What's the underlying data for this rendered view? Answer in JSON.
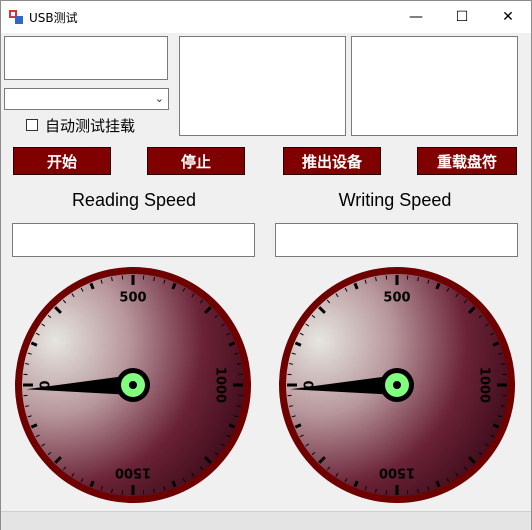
{
  "window": {
    "title": "USB测试",
    "minimize_glyph": "—",
    "maximize_glyph": "☐",
    "close_glyph": "✕"
  },
  "controls": {
    "auto_test_label": "自动测试挂载",
    "auto_test_checked": false,
    "drive_combo_value": "",
    "buttons": {
      "start": "开始",
      "stop": "停止",
      "eject": "推出设备",
      "reload": "重载盘符"
    }
  },
  "reading": {
    "title": "Reading Speed",
    "value_text": "",
    "gauge": {
      "labels": [
        "0",
        "500",
        "1000",
        "1500"
      ],
      "min": 0,
      "max": 2000,
      "value": 0
    }
  },
  "writing": {
    "title": "Writing Speed",
    "value_text": "",
    "gauge": {
      "labels": [
        "0",
        "500",
        "1000",
        "1500"
      ],
      "min": 0,
      "max": 2000,
      "value": 0
    }
  },
  "colors": {
    "accent": "#800000",
    "gauge_rim": "#6e0000",
    "needle": "#000000",
    "hub": "#80ff80"
  }
}
